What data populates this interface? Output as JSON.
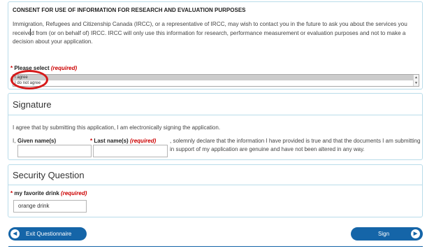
{
  "consent": {
    "title": "CONSENT FOR USE OF INFORMATION FOR RESEARCH AND EVALUATION PURPOSES",
    "body": "Immigration, Refugees and Citizenship Canada (IRCC), or a representative of IRCC, may wish to contact you in the future to ask you about the services you received from (or on behalf of) IRCC. IRCC will only use this information for research, performance measurement or evaluation purposes and not to make a decision about your application.",
    "select_label": "Please select",
    "required": "(required)",
    "options": [
      "I agree",
      "I do not agree"
    ],
    "selected": "I agree",
    "annotation_color": "#d61a1a"
  },
  "signature": {
    "heading": "Signature",
    "statement": "I agree that by submitting this application, I am electronically signing the application.",
    "i_text": "I,",
    "given_label": "Given name(s)",
    "last_label": "Last name(s)",
    "required": "(required)",
    "given_value": "",
    "last_value": "",
    "declaration": ", solemnly declare that the information I have provided is true and that the documents I am submitting in support of my application are genuine and have not been altered in any way."
  },
  "security": {
    "heading": "Security Question",
    "question_label": "my favorite drink",
    "required": "(required)",
    "answer_value": "orange drink"
  },
  "buttons": {
    "exit_label": "Exit Questionnaire",
    "exit_icon": "chevron-left-icon",
    "sign_label": "Sign",
    "sign_icon": "chevron-right-icon",
    "accent_color": "#1565a8"
  }
}
